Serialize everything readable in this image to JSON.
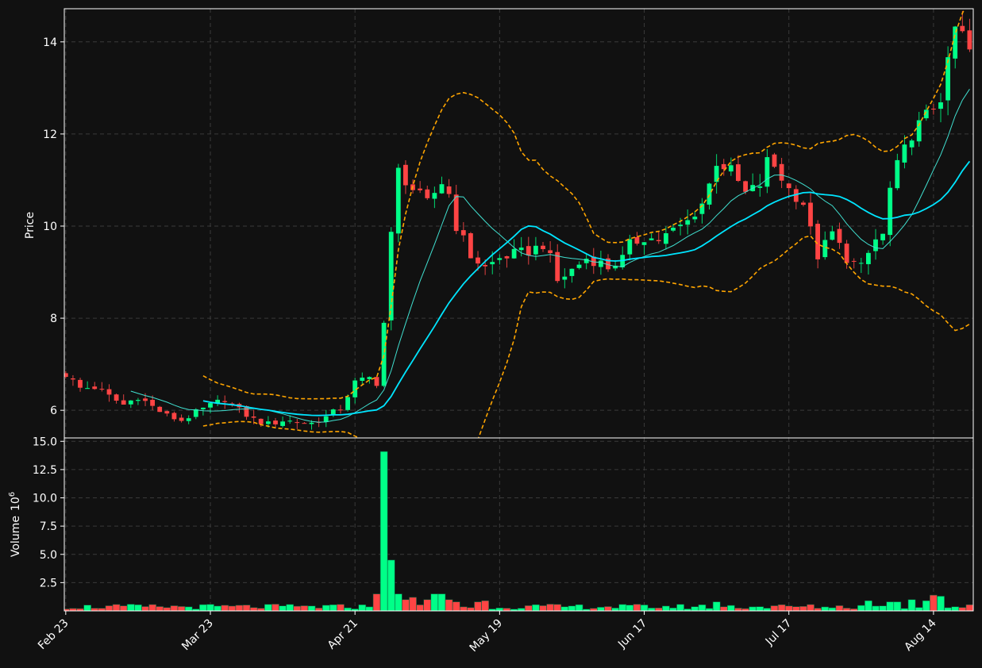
{
  "colors": {
    "background": "#111111",
    "up": "#00ff88",
    "down": "#ff4444",
    "wick_up": "#00d96f",
    "wick_down": "#e04040",
    "ma_fast": "#40e0d0",
    "ma_slow": "#00e5ff",
    "bollinger": "#ffa500",
    "grid": "#3a3a3a",
    "axis": "#ffffff"
  },
  "chart_data": {
    "type": "candlestick",
    "price_panel": {
      "ylabel": "Price",
      "ylim": [
        5.4,
        14.72
      ],
      "yticks": [
        6,
        8,
        10,
        12,
        14
      ]
    },
    "volume_panel": {
      "ylabel": "Volume",
      "ylabel_exponent": "6",
      "ylim": [
        0,
        15.3
      ],
      "yticks": [
        2.5,
        5.0,
        7.5,
        10.0,
        12.5,
        15.0
      ],
      "ytick_labels": [
        "2.5",
        "5.0",
        "7.5",
        "10.0",
        "12.5",
        "15.0"
      ]
    },
    "x_tick_labels": [
      {
        "index": 0,
        "label": "Feb 23"
      },
      {
        "index": 20,
        "label": "Mar 23"
      },
      {
        "index": 40,
        "label": "Apr 21"
      },
      {
        "index": 60,
        "label": "May 19"
      },
      {
        "index": 80,
        "label": "Jun 17"
      },
      {
        "index": 100,
        "label": "Jul 17"
      },
      {
        "index": 120,
        "label": "Aug 14"
      }
    ],
    "x_range": [
      -0.2,
      125.5
    ],
    "grid": true,
    "series_count": 125,
    "ohlc_anchors": [
      [
        0,
        6.78
      ],
      [
        2,
        6.48
      ],
      [
        4,
        6.5
      ],
      [
        6,
        6.3
      ],
      [
        8,
        6.12
      ],
      [
        10,
        6.3
      ],
      [
        12,
        6.08
      ],
      [
        14,
        5.88
      ],
      [
        16,
        5.78
      ],
      [
        18,
        5.95
      ],
      [
        20,
        6.1
      ],
      [
        22,
        6.25
      ],
      [
        24,
        6.0
      ],
      [
        26,
        5.8
      ],
      [
        28,
        5.7
      ],
      [
        30,
        5.78
      ],
      [
        32,
        5.75
      ],
      [
        34,
        5.72
      ],
      [
        36,
        5.85
      ],
      [
        38,
        6.05
      ],
      [
        40,
        6.6
      ],
      [
        42,
        6.7
      ],
      [
        43,
        6.6
      ],
      [
        44,
        7.9
      ],
      [
        45,
        9.8
      ],
      [
        46,
        11.2
      ],
      [
        47,
        11.0
      ],
      [
        48,
        10.8
      ],
      [
        50,
        10.5
      ],
      [
        52,
        10.95
      ],
      [
        53,
        10.7
      ],
      [
        54,
        10.0
      ],
      [
        55,
        9.7
      ],
      [
        56,
        9.35
      ],
      [
        58,
        9.1
      ],
      [
        60,
        9.3
      ],
      [
        62,
        9.4
      ],
      [
        64,
        9.45
      ],
      [
        66,
        9.6
      ],
      [
        67,
        9.3
      ],
      [
        68,
        8.8
      ],
      [
        70,
        9.05
      ],
      [
        72,
        9.3
      ],
      [
        74,
        9.2
      ],
      [
        75,
        9.1
      ],
      [
        76,
        9.2
      ],
      [
        77,
        9.3
      ],
      [
        78,
        9.6
      ],
      [
        80,
        9.75
      ],
      [
        82,
        9.7
      ],
      [
        84,
        9.9
      ],
      [
        86,
        10.1
      ],
      [
        88,
        10.5
      ],
      [
        89,
        10.9
      ],
      [
        90,
        11.4
      ],
      [
        92,
        11.2
      ],
      [
        94,
        10.7
      ],
      [
        96,
        10.9
      ],
      [
        97,
        11.4
      ],
      [
        98,
        11.3
      ],
      [
        100,
        10.8
      ],
      [
        102,
        10.5
      ],
      [
        103,
        9.9
      ],
      [
        104,
        9.35
      ],
      [
        106,
        9.85
      ],
      [
        108,
        9.3
      ],
      [
        109,
        9.2
      ],
      [
        110,
        9.1
      ],
      [
        112,
        9.7
      ],
      [
        113,
        9.8
      ],
      [
        114,
        10.8
      ],
      [
        115,
        11.3
      ],
      [
        117,
        12.0
      ],
      [
        118,
        12.2
      ],
      [
        120,
        12.6
      ],
      [
        121,
        12.8
      ],
      [
        122,
        13.5
      ],
      [
        123,
        14.3
      ],
      [
        124,
        14.15
      ],
      [
        125,
        13.8
      ]
    ],
    "volume_spikes": [
      {
        "index": 43,
        "value": 1.5
      },
      {
        "index": 44,
        "value": 14.1
      },
      {
        "index": 45,
        "value": 4.5
      },
      {
        "index": 46,
        "value": 1.5
      },
      {
        "index": 47,
        "value": 1.0
      },
      {
        "index": 48,
        "value": 1.2
      },
      {
        "index": 50,
        "value": 1.0
      },
      {
        "index": 51,
        "value": 1.5
      },
      {
        "index": 52,
        "value": 1.5
      },
      {
        "index": 53,
        "value": 1.0
      },
      {
        "index": 54,
        "value": 0.8
      },
      {
        "index": 57,
        "value": 0.8
      },
      {
        "index": 58,
        "value": 0.9
      },
      {
        "index": 90,
        "value": 0.8
      },
      {
        "index": 111,
        "value": 0.9
      },
      {
        "index": 114,
        "value": 0.8
      },
      {
        "index": 115,
        "value": 0.8
      },
      {
        "index": 117,
        "value": 1.0
      },
      {
        "index": 119,
        "value": 0.9
      },
      {
        "index": 120,
        "value": 1.4
      },
      {
        "index": 121,
        "value": 1.3
      }
    ],
    "moving_average_windows": [
      10,
      20
    ],
    "bollinger_window": 20,
    "bollinger_k": 2
  }
}
